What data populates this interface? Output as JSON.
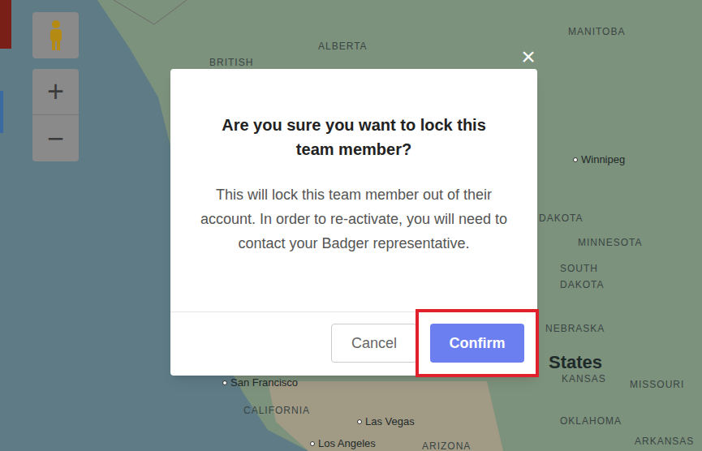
{
  "map": {
    "labels": [
      {
        "text": "ALBERTA",
        "kind": "region"
      },
      {
        "text": "MANITOBA",
        "kind": "region"
      },
      {
        "text": "BRITISH",
        "kind": "region"
      },
      {
        "text": "Winnipeg",
        "kind": "city"
      },
      {
        "text": "DAKOTA",
        "kind": "region"
      },
      {
        "text": "MINNESOTA",
        "kind": "region"
      },
      {
        "text": "SOUTH",
        "kind": "region"
      },
      {
        "text": "DAKOTA",
        "kind": "region"
      },
      {
        "text": "NEBRASKA",
        "kind": "region"
      },
      {
        "text": "States",
        "kind": "country"
      },
      {
        "text": "KANSAS",
        "kind": "region"
      },
      {
        "text": "MISSOURI",
        "kind": "region"
      },
      {
        "text": "OKLAHOMA",
        "kind": "region"
      },
      {
        "text": "ARKANSAS",
        "kind": "region"
      },
      {
        "text": "San Francisco",
        "kind": "city"
      },
      {
        "text": "CALIFORNIA",
        "kind": "region"
      },
      {
        "text": "Las Vegas",
        "kind": "city"
      },
      {
        "text": "Los Angeles",
        "kind": "city"
      },
      {
        "text": "ARIZONA",
        "kind": "region"
      }
    ]
  },
  "map_controls": {
    "zoom_in": "+",
    "zoom_out": "−"
  },
  "dialog": {
    "close": "×",
    "title": "Are you sure you want to lock this team member?",
    "body": "This will lock this team member out of their account. In order to re-activate, you will need to contact your Badger representative.",
    "buttons": [
      {
        "label": "Cancel",
        "primary": false,
        "highlighted": false
      },
      {
        "label": "Confirm",
        "primary": true,
        "highlighted": true
      }
    ]
  }
}
